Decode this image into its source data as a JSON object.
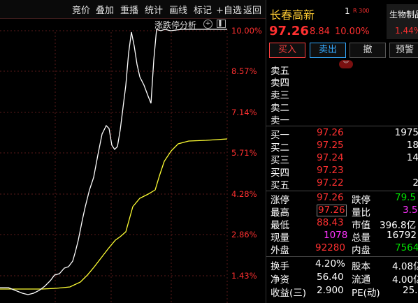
{
  "toolbar": {
    "items": [
      "竞价",
      "叠加",
      "重播",
      "统计",
      "画线",
      "标记",
      "+自选",
      "返回"
    ]
  },
  "chart": {
    "title": "涨跌停分析",
    "pct_labels": [
      "10.00%",
      "8.57%",
      "7.14%",
      "5.71%",
      "4.28%",
      "2.86%",
      "1.43%"
    ]
  },
  "quote": {
    "name": "长春高新",
    "rank": "1",
    "badge": "R 300",
    "sector": "生物制品",
    "sector_pct": "1.44%",
    "price": "97.26",
    "change": "8.84",
    "change_pct": "10.00%"
  },
  "buttons": {
    "buy": "买入",
    "sell": "卖出",
    "cancel": "撤",
    "alert": "预警"
  },
  "asks": [
    {
      "label": "卖五",
      "price": "",
      "vol": ""
    },
    {
      "label": "卖四",
      "price": "",
      "vol": ""
    },
    {
      "label": "卖三",
      "price": "",
      "vol": ""
    },
    {
      "label": "卖二",
      "price": "",
      "vol": ""
    },
    {
      "label": "卖一",
      "price": "",
      "vol": ""
    }
  ],
  "bids": [
    {
      "label": "买一",
      "price": "97.26",
      "vol": "1975"
    },
    {
      "label": "买二",
      "price": "97.25",
      "vol": "18"
    },
    {
      "label": "买三",
      "price": "97.24",
      "vol": "14"
    },
    {
      "label": "买四",
      "price": "97.23",
      "vol": ""
    },
    {
      "label": "买五",
      "price": "97.22",
      "vol": "2"
    }
  ],
  "stats": [
    {
      "l1": "涨停",
      "v1": "97.26",
      "c1": "red",
      "l2": "跌停",
      "v2": "79.5",
      "c2": "green"
    },
    {
      "l1": "最高",
      "v1": "97.26",
      "c1": "red",
      "l2": "量比",
      "v2": "3.5",
      "c2": "mag"
    },
    {
      "l1": "最低",
      "v1": "88.43",
      "c1": "red",
      "l2": "市值",
      "v2": "396.8亿",
      "c2": "white"
    },
    {
      "l1": "现量",
      "v1": "1078",
      "c1": "mag",
      "l2": "总量",
      "v2": "16792",
      "c2": "white"
    },
    {
      "l1": "外盘",
      "v1": "92280",
      "c1": "red",
      "l2": "内盘",
      "v2": "7564",
      "c2": "green"
    }
  ],
  "fundamentals": [
    {
      "l1": "换手",
      "v1": "4.20%",
      "l2": "股本",
      "v2": "4.08亿"
    },
    {
      "l1": "净资",
      "v1": "56.40",
      "l2": "流通",
      "v2": "4.00亿"
    },
    {
      "l1": "收益(三)",
      "v1": "2.900",
      "l2": "PE(动)",
      "v2": "25."
    }
  ]
}
